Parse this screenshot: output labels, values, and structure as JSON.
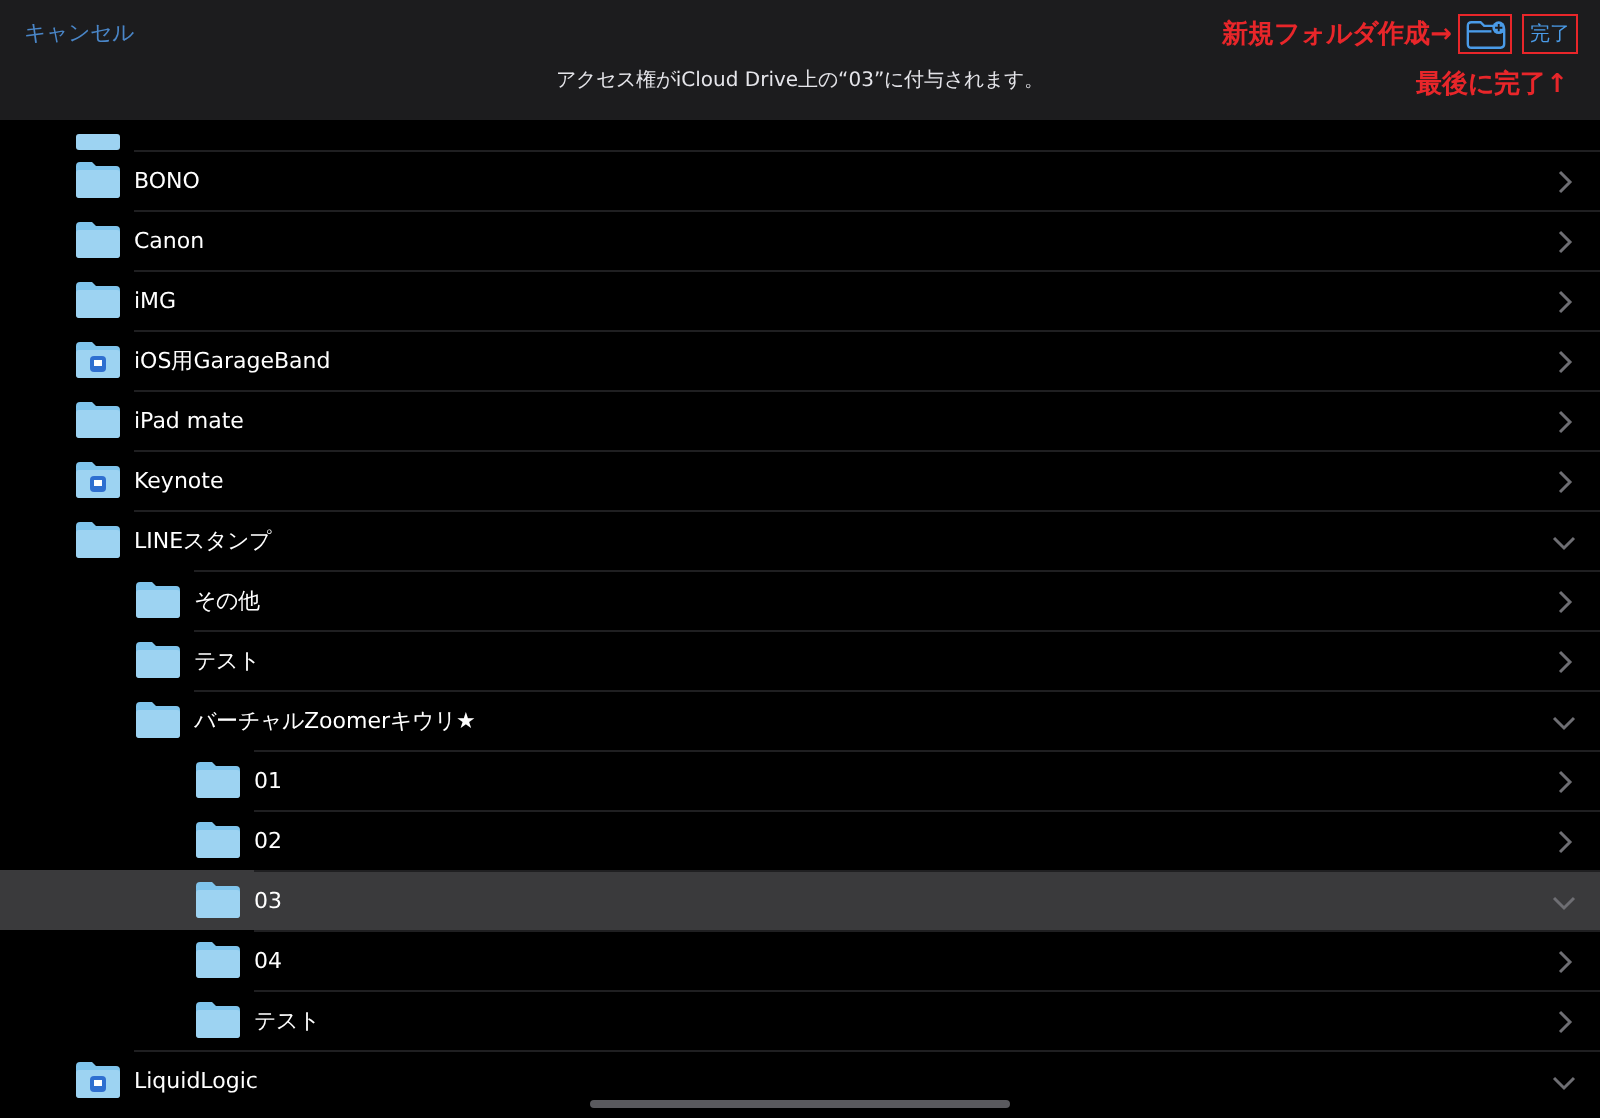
{
  "header": {
    "cancel": "キャンセル",
    "message": "アクセス権がiCloud Drive上の“03”に付与されます。",
    "done": "完了"
  },
  "annotations": {
    "new_folder": "新規フォルダ作成→",
    "done_last": "最後に完了↑"
  },
  "folders": [
    {
      "name": "BONO",
      "kind": "folder",
      "expanded": false,
      "selected": false
    },
    {
      "name": "Canon",
      "kind": "folder",
      "expanded": false,
      "selected": false
    },
    {
      "name": "iMG",
      "kind": "folder",
      "expanded": false,
      "selected": false
    },
    {
      "name": "iOS用GarageBand",
      "kind": "app-folder",
      "expanded": false,
      "selected": false
    },
    {
      "name": "iPad mate",
      "kind": "folder",
      "expanded": false,
      "selected": false
    },
    {
      "name": "Keynote",
      "kind": "app-folder",
      "expanded": false,
      "selected": false
    },
    {
      "name": "LINEスタンプ",
      "kind": "folder",
      "expanded": true,
      "selected": false,
      "children": [
        {
          "name": "その他",
          "kind": "folder",
          "expanded": false,
          "selected": false
        },
        {
          "name": "テスト",
          "kind": "folder",
          "expanded": false,
          "selected": false
        },
        {
          "name": "バーチャルZoomerキウリ★",
          "kind": "folder",
          "expanded": true,
          "selected": false,
          "children": [
            {
              "name": "01",
              "kind": "folder",
              "expanded": false,
              "selected": false
            },
            {
              "name": "02",
              "kind": "folder",
              "expanded": false,
              "selected": false
            },
            {
              "name": "03",
              "kind": "folder",
              "expanded": true,
              "selected": true
            },
            {
              "name": "04",
              "kind": "folder",
              "expanded": false,
              "selected": false
            },
            {
              "name": "テスト",
              "kind": "folder",
              "expanded": false,
              "selected": false
            }
          ]
        }
      ]
    },
    {
      "name": "LiquidLogic",
      "kind": "app-folder",
      "expanded": true,
      "selected": false
    }
  ]
}
